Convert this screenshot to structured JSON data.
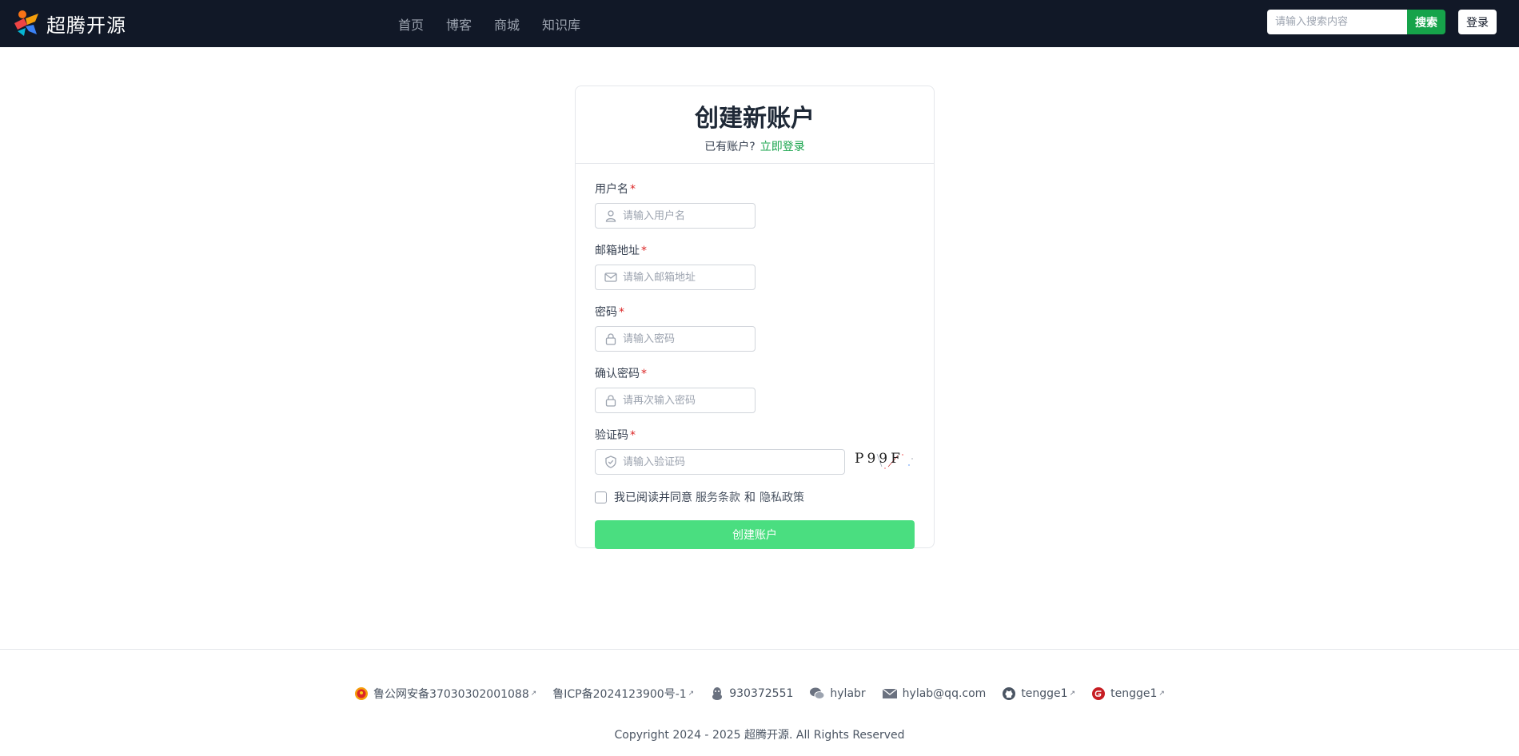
{
  "header": {
    "brand": "超腾开源",
    "nav": [
      {
        "label": "首页"
      },
      {
        "label": "博客"
      },
      {
        "label": "商城"
      },
      {
        "label": "知识库"
      }
    ],
    "search_placeholder": "请输入搜索内容",
    "search_label": "搜索",
    "login_label": "登录"
  },
  "card": {
    "title": "创建新账户",
    "has_account": "已有账户?",
    "login_link": "立即登录"
  },
  "form": {
    "username_label": "用户名",
    "username_placeholder": "请输入用户名",
    "email_label": "邮箱地址",
    "email_placeholder": "请输入邮箱地址",
    "password_label": "密码",
    "password_placeholder": "请输入密码",
    "confirm_label": "确认密码",
    "confirm_placeholder": "请再次输入密码",
    "captcha_label": "验证码",
    "captcha_placeholder": "请输入验证码",
    "captcha_text": "P99F",
    "required_mark": "*",
    "agree_prefix": "我已阅读并同意",
    "terms": "服务条款",
    "and": "和",
    "privacy": "隐私政策",
    "submit_label": "创建账户"
  },
  "footer": {
    "police": "鲁公网安备37030302001088",
    "icp": "鲁ICP备2024123900号-1",
    "qq": "930372551",
    "wechat": "hylabr",
    "email": "hylab@qq.com",
    "github": "tengge1",
    "gitee": "tengge1",
    "ext_mark": "↗",
    "copyright": "Copyright 2024 - 2025 超腾开源. All Rights Reserved"
  },
  "colors": {
    "header_bg": "#111827",
    "accent": "#16a34a",
    "submit_bg": "#4ade80",
    "required": "#dc2626"
  }
}
